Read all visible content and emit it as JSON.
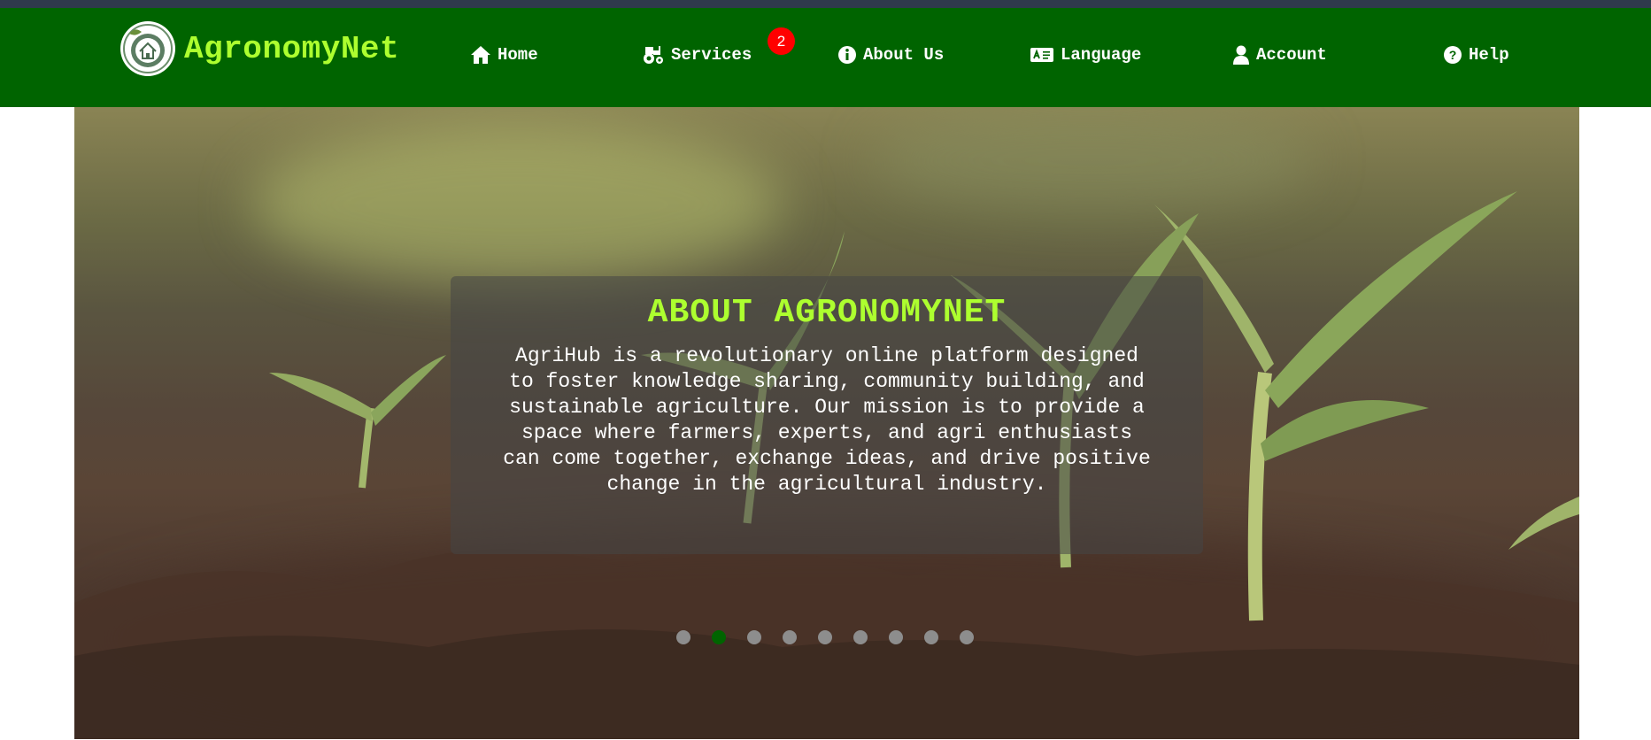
{
  "brand": {
    "name": "AgronomyNet",
    "logo_icon": "house-leaf-logo-icon"
  },
  "nav": {
    "items": [
      {
        "label": "Home",
        "icon": "home-icon"
      },
      {
        "label": "Services",
        "icon": "tractor-icon",
        "badge": "2"
      },
      {
        "label": "About Us",
        "icon": "info-icon"
      },
      {
        "label": "Language",
        "icon": "language-icon"
      },
      {
        "label": "Account",
        "icon": "user-icon"
      },
      {
        "label": "Help",
        "icon": "help-icon"
      }
    ]
  },
  "hero": {
    "title": "ABOUT AGRONOMYNET",
    "text": "AgriHub is a revolutionary online platform designed to foster knowledge sharing, community building, and sustainable agriculture. Our mission is to provide a space where farmers, experts, and agri enthusiasts can come together, exchange ideas, and drive positive change in the agricultural industry.",
    "background_image": "seedlings-in-soil-photo",
    "slides_total": 9,
    "active_slide": 2
  },
  "colors": {
    "navbar": "#006400",
    "top_strip": "#2f3a4c",
    "brand_accent": "#adff2f",
    "badge": "#ff0000",
    "dot_inactive": "#8d8d8d",
    "dot_active": "#006400"
  }
}
